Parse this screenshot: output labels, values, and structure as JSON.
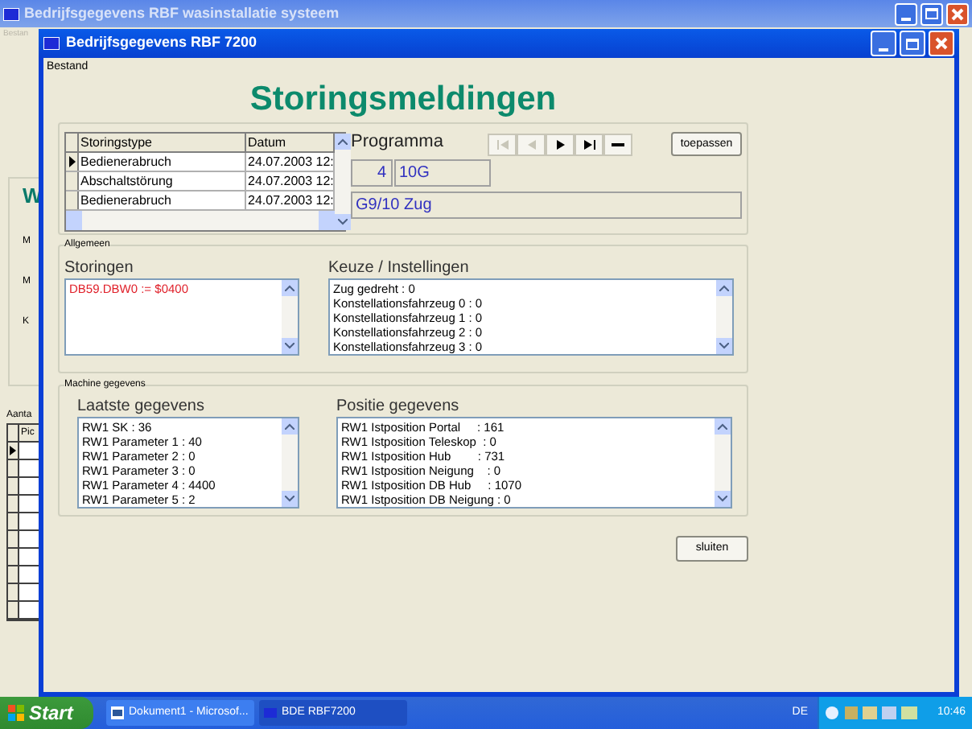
{
  "background_window": {
    "title": "Bedrijfsgegevens RBF wasinstallatie systeem",
    "menu": [
      "Bestan"
    ],
    "panel_heading": "W",
    "panel_labels": [
      "M",
      "M",
      "K"
    ],
    "grid_label": "Aanta",
    "grid_column": "Pic",
    "grid_rows": [
      {
        "current": true
      },
      {
        "current": false
      },
      {
        "current": false
      },
      {
        "current": false
      },
      {
        "current": false
      },
      {
        "current": false
      },
      {
        "current": false
      },
      {
        "current": false
      },
      {
        "current": false
      },
      {
        "current": false
      }
    ]
  },
  "window": {
    "title": "Bedrijfsgegevens RBF 7200",
    "menu": [
      "Bestand"
    ]
  },
  "heading": "Storingsmeldingen",
  "fault_grid": {
    "columns": [
      "Storingstype",
      "Datum"
    ],
    "rows": [
      {
        "cells": [
          "Bedienerabruch",
          "24.07.2003 12:"
        ],
        "current": true
      },
      {
        "cells": [
          "Abschaltstörung",
          "24.07.2003 12:"
        ],
        "current": false
      },
      {
        "cells": [
          "Bedienerabruch",
          "24.07.2003 12:"
        ],
        "current": false
      }
    ]
  },
  "programma": {
    "label": "Programma",
    "number": "4",
    "code": "10G",
    "description": "G9/10 Zug"
  },
  "nav_buttons": [
    {
      "kind": "first",
      "disabled": true
    },
    {
      "kind": "prev",
      "disabled": true
    },
    {
      "kind": "next",
      "disabled": false
    },
    {
      "kind": "last",
      "disabled": false
    },
    {
      "kind": "delete",
      "disabled": false
    }
  ],
  "apply_button": "toepassen",
  "allgemeen": {
    "title": "Allgemeen",
    "storingen": {
      "label": "Storingen",
      "lines": [
        "DB59.DBW0 := $0400"
      ]
    },
    "keuze": {
      "label": "Keuze / Instellingen",
      "lines": [
        "Zug gedreht : 0",
        "Konstellationsfahrzeug 0 : 0",
        "Konstellationsfahrzeug 1 : 0",
        "Konstellationsfahrzeug 2 : 0",
        "Konstellationsfahrzeug 3 : 0"
      ]
    }
  },
  "machine": {
    "title": "Machine gegevens",
    "laatste": {
      "label": "Laatste gegevens",
      "lines": [
        "RW1 SK : 36",
        "RW1 Parameter 1 : 40",
        "RW1 Parameter 2 : 0",
        "RW1 Parameter 3 : 0",
        "RW1 Parameter 4 : 4400",
        "RW1 Parameter 5 : 2"
      ]
    },
    "positie": {
      "label": "Positie gegevens",
      "lines": [
        "RW1 Istposition Portal     : 161",
        "RW1 Istposition Teleskop  : 0",
        "RW1 Istposition Hub        : 731",
        "RW1 Istposition Neigung    : 0",
        "RW1 Istposition DB Hub     : 1070",
        "RW1 Istposition DB Neigung : 0"
      ]
    }
  },
  "close_button": "sluiten",
  "taskbar": {
    "start": "Start",
    "tasks": [
      {
        "label": "Dokument1 - Microsof...",
        "active": false,
        "kind": "word"
      },
      {
        "label": "BDE RBF7200",
        "active": true,
        "kind": "app"
      }
    ],
    "language": "DE",
    "clock": "10:46"
  }
}
